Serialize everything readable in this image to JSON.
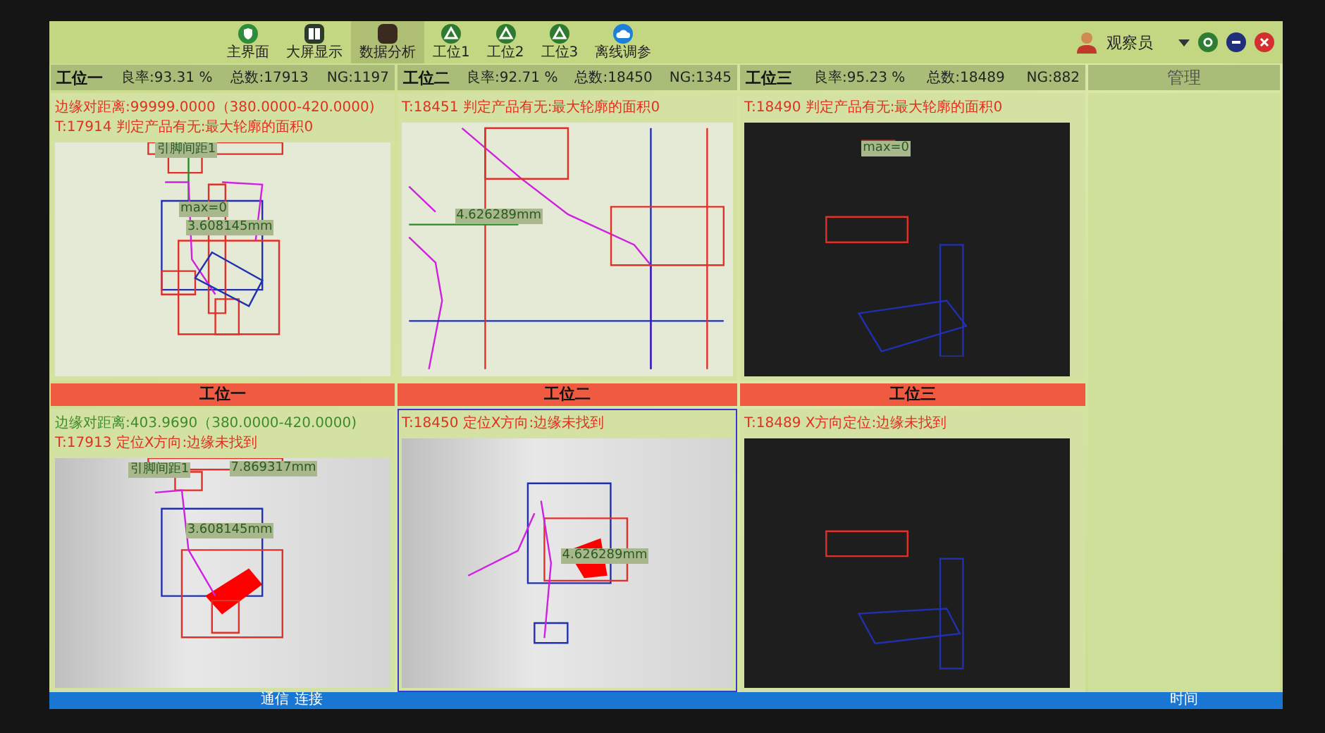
{
  "toolbar": {
    "items": [
      {
        "label": "主界面",
        "selected": false
      },
      {
        "label": "大屏显示",
        "selected": false
      },
      {
        "label": "数据分析",
        "selected": true
      },
      {
        "label": "工位1",
        "selected": false
      },
      {
        "label": "工位2",
        "selected": false
      },
      {
        "label": "工位3",
        "selected": false
      },
      {
        "label": "离线调参",
        "selected": false
      }
    ],
    "user": "观察员"
  },
  "top_stations": [
    {
      "name": "工位一",
      "yield": "良率:93.31 %",
      "total": "总数:17913",
      "ng": "NG:1197",
      "kind": "light",
      "messages": [
        {
          "text": "边缘对距离:99999.0000（380.0000-420.0000)",
          "error": true
        },
        {
          "text": "T:17914  判定产品有无:最大轮廓的面积0",
          "error": true
        }
      ],
      "labels": [
        "引脚间距1",
        "max=0",
        "3.608145mm"
      ]
    },
    {
      "name": "工位二",
      "yield": "良率:92.71 %",
      "total": "总数:18450",
      "ng": "NG:1345",
      "kind": "light",
      "messages": [
        {
          "text": "T:18451  判定产品有无:最大轮廓的面积0",
          "error": true
        }
      ],
      "labels": [
        "4.626289mm"
      ]
    },
    {
      "name": "工位三",
      "yield": "良率:95.23 %",
      "total": "总数:18489",
      "ng": "NG:882",
      "kind": "dark",
      "messages": [
        {
          "text": "T:18490  判定产品有无:最大轮廓的面积0",
          "error": true
        }
      ],
      "labels": [
        "max=0"
      ]
    }
  ],
  "side_panel": {
    "title": "管理"
  },
  "bottom_stations": [
    {
      "name": "工位一",
      "selected": false,
      "kind": "photo",
      "messages": [
        {
          "text": "边缘对距离:403.9690（380.0000-420.0000)",
          "error": false
        },
        {
          "text": "T:17913  定位X方向:边缘未找到",
          "error": true
        }
      ],
      "labels": [
        "引脚间距1",
        "7.869317mm",
        "3.608145mm"
      ]
    },
    {
      "name": "工位二",
      "selected": true,
      "kind": "photo",
      "messages": [
        {
          "text": "T:18450  定位X方向:边缘未找到",
          "error": true
        }
      ],
      "labels": [
        "4.626289mm"
      ]
    },
    {
      "name": "工位三",
      "selected": false,
      "kind": "dark",
      "messages": [
        {
          "text": "T:18489  X方向定位:边缘未找到",
          "error": true
        }
      ]
    }
  ],
  "status_bar": {
    "left": [
      "通信",
      "连接"
    ],
    "right": "时间"
  }
}
